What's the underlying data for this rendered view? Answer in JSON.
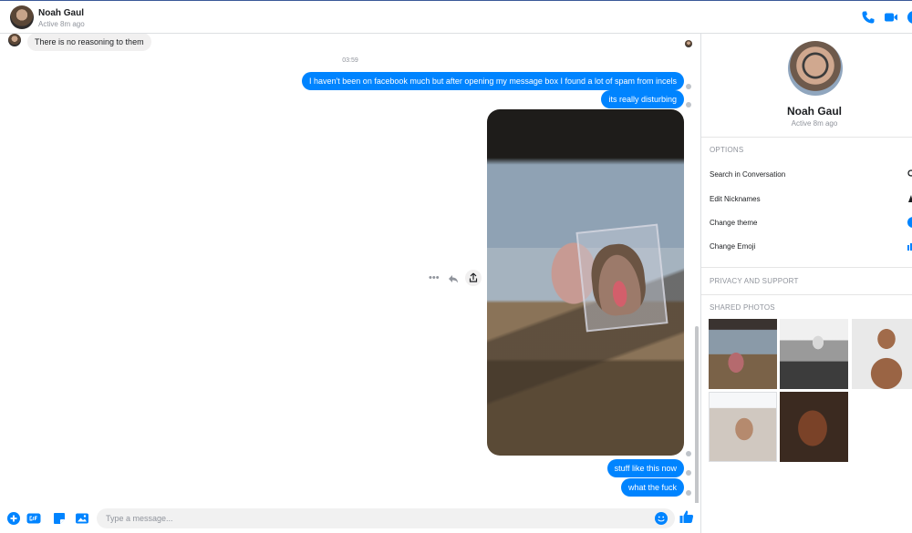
{
  "header": {
    "name": "Noah Gaul",
    "status": "Active 8m ago",
    "icons": [
      "phone-icon",
      "video-camera-icon",
      "info-icon"
    ]
  },
  "colors": {
    "brand_blue": "#0084ff",
    "incoming_bubble": "#f1f0f0",
    "muted_text": "#90949c"
  },
  "thread": {
    "previous_message": "There is no reasoning to them",
    "timestamp": "03:59",
    "messages_out": [
      "I haven't been on facebook much but after opening my message box I found a lot of spam from incels",
      "its really disturbing",
      "stuff like this now",
      "what the fuck"
    ],
    "hover_actions": [
      "more-icon",
      "reply-icon",
      "share-icon"
    ]
  },
  "composer": {
    "placeholder": "Type a message...",
    "icons": [
      "add-icon",
      "gif-icon",
      "sticker-icon",
      "photo-icon",
      "emoji-icon",
      "like-icon"
    ]
  },
  "panel": {
    "name": "Noah Gaul",
    "status": "Active 8m ago",
    "options_title": "OPTIONS",
    "options": [
      "Search in Conversation",
      "Edit Nicknames",
      "Change theme",
      "Change Emoji"
    ],
    "privacy_title": "PRIVACY AND SUPPORT",
    "shared_title": "SHARED PHOTOS"
  }
}
